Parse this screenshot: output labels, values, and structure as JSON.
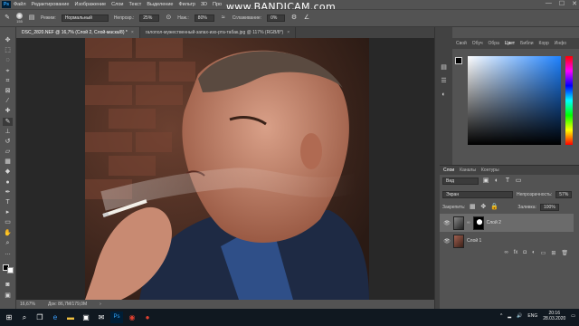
{
  "app": {
    "logo": "Ps",
    "menu": [
      "Файл",
      "Редактирование",
      "Изображение",
      "Слои",
      "Текст",
      "Выделение",
      "Фильтр",
      "3D",
      "Про"
    ],
    "watermark": "www.BANDICAM.com",
    "window_controls": [
      "—",
      "☐",
      "✕"
    ]
  },
  "options_bar": {
    "brush_size": "155",
    "mode_label": "Режим:",
    "mode_value": "Нормальный",
    "opacity_label": "Непрозр.:",
    "opacity_value": "25%",
    "flow_label": "Наж.:",
    "flow_value": "80%",
    "smoothing_label": "Сглаживание:",
    "smoothing_value": "0%"
  },
  "tabs": [
    {
      "label": "DSC_2820.NEF @ 16,7% (Слой 2, Слой-маска/8) *",
      "close": "×"
    },
    {
      "label": "галопол-мужественный-запах-изо-рта-табак.jpg @ 117% (RGB/8*)",
      "close": "×"
    }
  ],
  "status": {
    "zoom": "16,67%",
    "doc_info": "Док: 86,7M/179,0M",
    "arrow": "›"
  },
  "color_panel": {
    "tabs": [
      "Свой",
      "Обуч",
      "Обра",
      "Цвет",
      "Библи",
      "Корр",
      "Инфо"
    ],
    "active_tab": "Цвет",
    "fg_color": "#000000",
    "bg_color": "#ffffff",
    "hue_color": "#1e82ff"
  },
  "layers_panel": {
    "tabs": [
      "Слои",
      "Каналы",
      "Контуры"
    ],
    "filter_value": "Вид",
    "blend_mode": "Экран",
    "opacity_label": "Непрозрачность:",
    "opacity_value": "57%",
    "lock_label": "Закрепить:",
    "fill_label": "Заливка:",
    "fill_value": "100%",
    "layers": [
      {
        "name": "Слой 2",
        "selected": true
      },
      {
        "name": "Слой 1",
        "selected": false
      }
    ],
    "footer_icons": [
      "link-icon",
      "fx-icon",
      "mask-icon",
      "adjustment-icon",
      "folder-icon",
      "new-layer-icon",
      "trash-icon"
    ]
  },
  "taskbar": {
    "language": "ENG",
    "time": "20:16",
    "date": "28.03.2020"
  }
}
